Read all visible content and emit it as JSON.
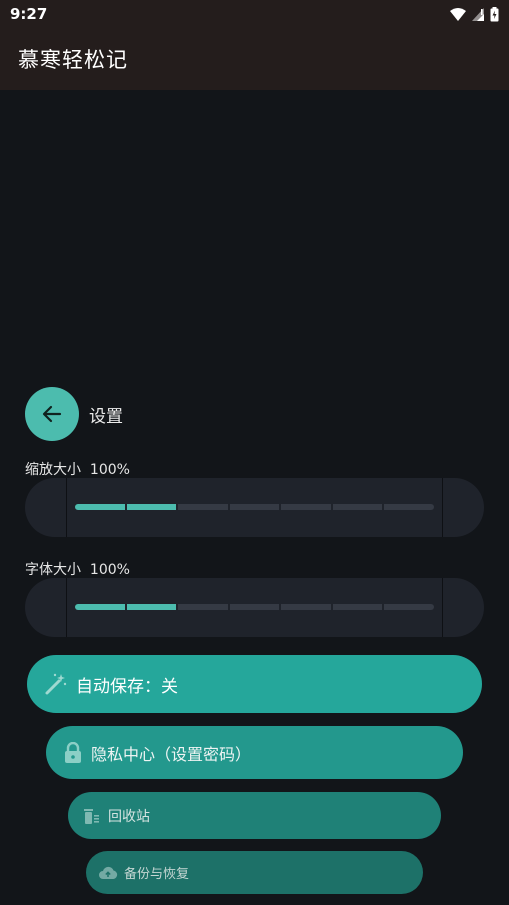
{
  "status_bar": {
    "time": "9:27",
    "icons": [
      "wifi-icon",
      "signal-icon",
      "battery-charging-icon"
    ]
  },
  "app_bar": {
    "title": "慕寒轻松记"
  },
  "settings": {
    "back_icon": "arrow-left-icon",
    "title": "设置"
  },
  "zoom": {
    "label": "缩放大小",
    "value": "100%",
    "level_segments_filled": 2,
    "segments_total": 7
  },
  "font_size": {
    "label": "字体大小",
    "value": "100%",
    "level_segments_filled": 2,
    "segments_total": 7
  },
  "actions": {
    "auto_save": {
      "icon": "magic-wand-icon",
      "label": "自动保存：关"
    },
    "privacy": {
      "icon": "lock-icon",
      "label": "隐私中心（设置密码）"
    },
    "trash": {
      "icon": "trash-icon",
      "label": "回收站"
    },
    "backup": {
      "icon": "cloud-icon",
      "label": "备份与恢复"
    }
  },
  "colors": {
    "accent": "#4cbcae",
    "app_bar": "#241d1c",
    "background": "#121519"
  }
}
